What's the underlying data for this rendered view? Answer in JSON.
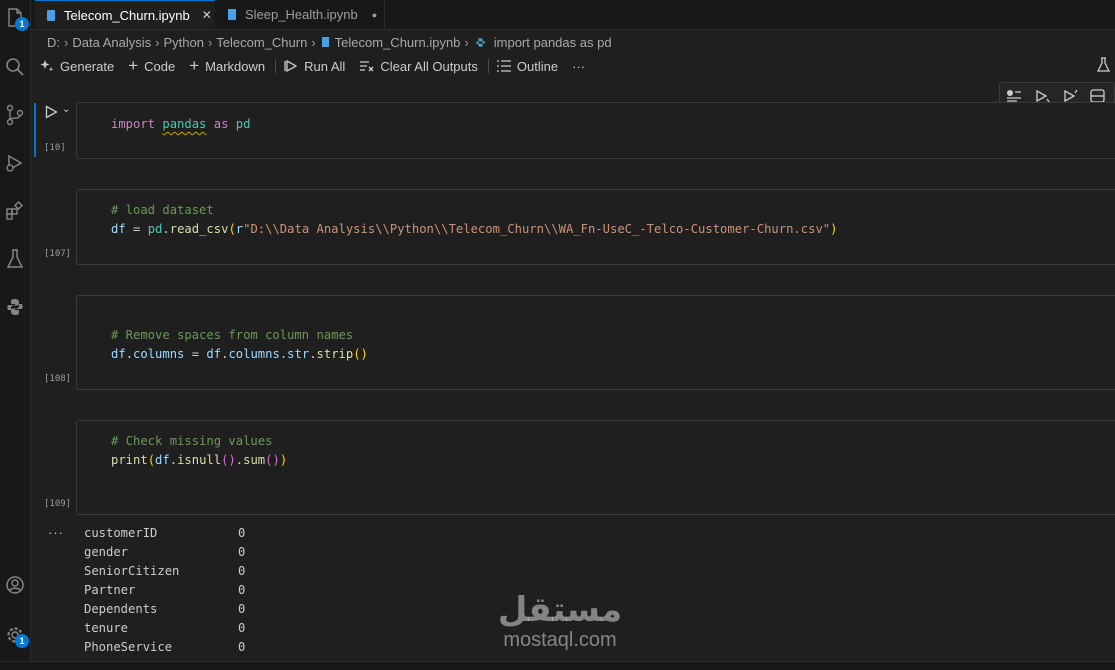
{
  "tabs": [
    {
      "label": "Telecom_Churn.ipynb",
      "close": "✕"
    },
    {
      "label": "Sleep_Health.ipynb",
      "dot": "●"
    }
  ],
  "activity": {
    "explorer_badge": "1",
    "settings_badge": "1"
  },
  "breadcrumb": [
    "D:",
    "Data Analysis",
    "Python",
    "Telecom_Churn",
    "Telecom_Churn.ipynb",
    "import pandas as pd"
  ],
  "toolbar": {
    "generate": "Generate",
    "code": "Code",
    "markdown": "Markdown",
    "run_all": "Run All",
    "clear_outputs": "Clear All Outputs",
    "outline": "Outline",
    "more": "···"
  },
  "cells": [
    {
      "exec": "[10]",
      "code": {
        "kw1": "import",
        "mod": "pandas",
        "kw2": "as",
        "alias": "pd"
      }
    },
    {
      "exec": "[107]",
      "comment": "# load dataset",
      "code": {
        "var1": "df",
        "eq": " = ",
        "obj": "pd",
        "dot": ".",
        "fn": "read_csv",
        "open": "(",
        "prefix": "r",
        "str": "\"D:\\\\Data Analysis\\\\Python\\\\Telecom_Churn\\\\WA_Fn-UseC_-Telco-Customer-Churn.csv\"",
        "close": ")"
      }
    },
    {
      "exec": "[108]",
      "comment": "# Remove spaces from column names",
      "code": {
        "lhs_obj": "df",
        "lhs_attr": "columns",
        "eq": " = ",
        "rhs_obj": "df",
        "rhs_attr1": "columns",
        "rhs_attr2": "str",
        "fn": "strip",
        "parens": "()"
      }
    },
    {
      "exec": "[109]",
      "comment": "# Check missing values",
      "code": {
        "fn1": "print",
        "open": "(",
        "obj": "df",
        "fn2": "isnull",
        "fn3": "sum",
        "p_inner": "()",
        "close": ")"
      }
    }
  ],
  "output": {
    "more": "···",
    "rows": [
      {
        "name": "customerID",
        "value": "0"
      },
      {
        "name": "gender",
        "value": "0"
      },
      {
        "name": "SeniorCitizen",
        "value": "0"
      },
      {
        "name": "Partner",
        "value": "0"
      },
      {
        "name": "Dependents",
        "value": "0"
      },
      {
        "name": "tenure",
        "value": "0"
      },
      {
        "name": "PhoneService",
        "value": "0"
      }
    ]
  },
  "watermark": {
    "arabic": "مستقل",
    "latin": "mostaql.com"
  },
  "colors": {
    "accent": "#0078d4",
    "background": "#1f1f1f",
    "comment": "#6a9955",
    "keyword": "#c586c0",
    "function": "#dcdcaa",
    "string": "#ce9178",
    "variable": "#9cdcfe"
  }
}
